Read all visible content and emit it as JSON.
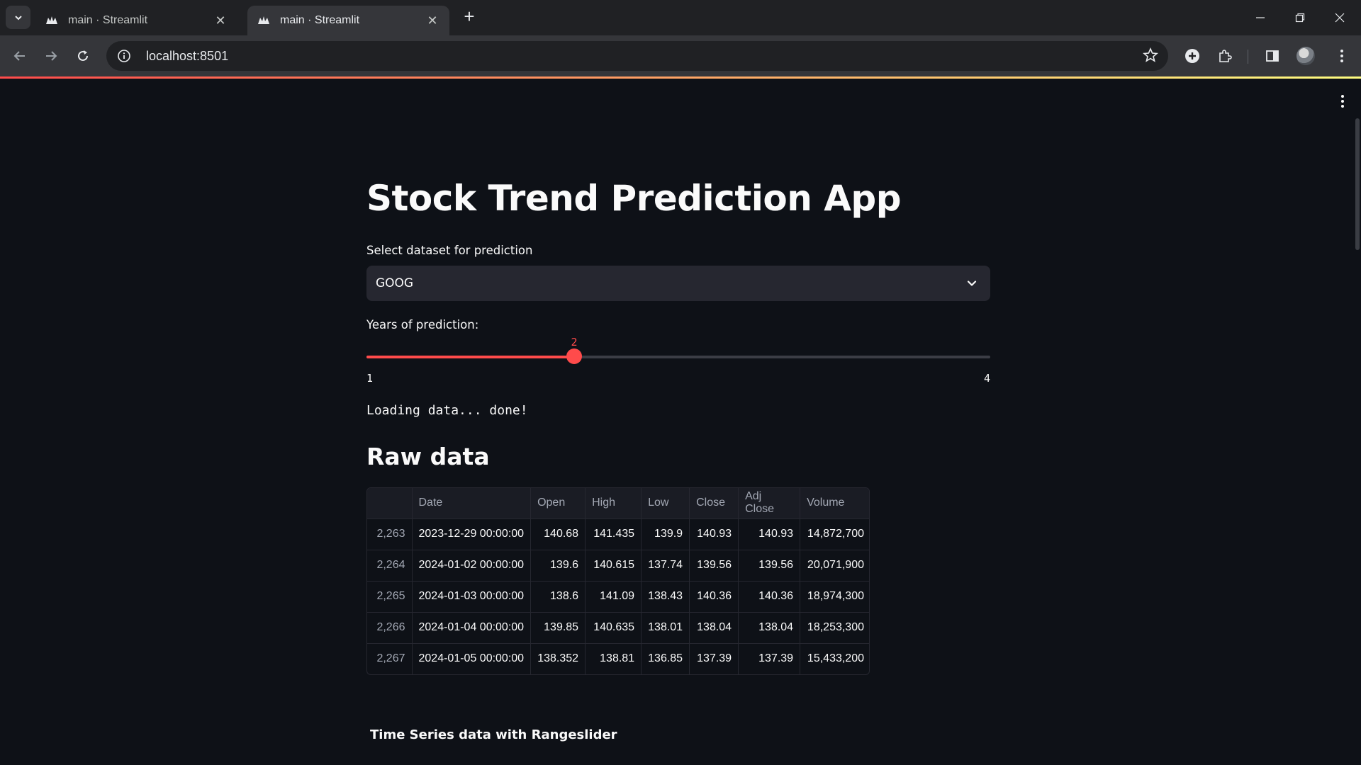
{
  "browser": {
    "tabs": [
      {
        "title": "main · Streamlit",
        "active": false
      },
      {
        "title": "main · Streamlit",
        "active": true
      }
    ],
    "url": "localhost:8501"
  },
  "app": {
    "title": "Stock Trend Prediction App",
    "dataset_select": {
      "label": "Select dataset for prediction",
      "value": "GOOG"
    },
    "years_slider": {
      "label": "Years of prediction:",
      "value": "2",
      "min": "1",
      "max": "4"
    },
    "status": "Loading data... done!",
    "raw_data": {
      "heading": "Raw data",
      "columns": [
        "",
        "Date",
        "Open",
        "High",
        "Low",
        "Close",
        "Adj Close",
        "Volume"
      ],
      "rows": [
        [
          "2,263",
          "2023-12-29 00:00:00",
          "140.68",
          "141.435",
          "139.9",
          "140.93",
          "140.93",
          "14,872,700"
        ],
        [
          "2,264",
          "2024-01-02 00:00:00",
          "139.6",
          "140.615",
          "137.74",
          "139.56",
          "139.56",
          "20,071,900"
        ],
        [
          "2,265",
          "2024-01-03 00:00:00",
          "138.6",
          "141.09",
          "138.43",
          "140.36",
          "140.36",
          "18,974,300"
        ],
        [
          "2,266",
          "2024-01-04 00:00:00",
          "139.85",
          "140.635",
          "138.01",
          "138.04",
          "138.04",
          "18,253,300"
        ],
        [
          "2,267",
          "2024-01-05 00:00:00",
          "138.352",
          "138.81",
          "136.85",
          "137.39",
          "137.39",
          "15,433,200"
        ]
      ]
    },
    "chart_section_title": "Time Series data with Rangeslider"
  },
  "colors": {
    "accent": "#ff4b4b",
    "background": "#0e1117",
    "widget_bg": "#262730"
  }
}
